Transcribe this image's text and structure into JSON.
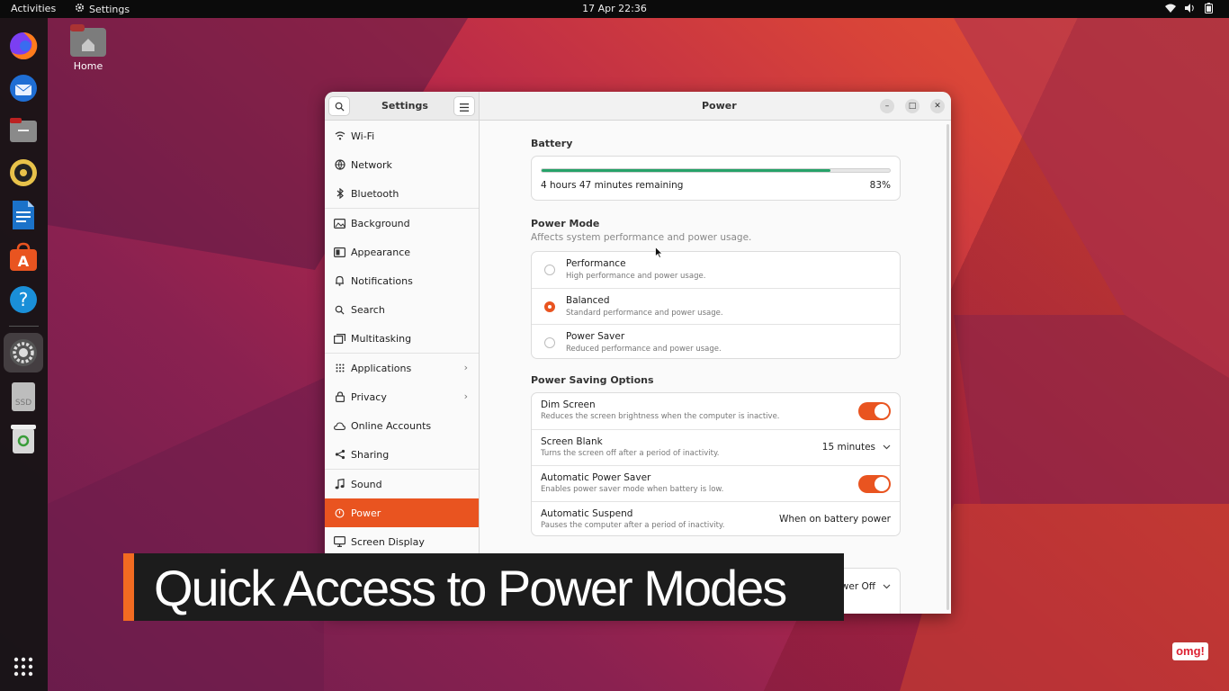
{
  "topbar": {
    "activities": "Activities",
    "app_name": "Settings",
    "clock": "17 Apr  22:36"
  },
  "dock": {
    "items": [
      "firefox-icon",
      "thunderbird-icon",
      "files-icon",
      "rhythmbox-icon",
      "writer-icon",
      "app-center-icon",
      "help-icon",
      "settings-icon",
      "ssd-drive-icon",
      "trash-icon",
      "show-apps-icon"
    ],
    "ssd_label": "SSD"
  },
  "desktop": {
    "home_label": "Home"
  },
  "window": {
    "sidebar_title": "Settings",
    "main_title": "Power",
    "sidebar": [
      {
        "label": "Wi-Fi",
        "icon": "wifi-icon"
      },
      {
        "label": "Network",
        "icon": "network-icon"
      },
      {
        "label": "Bluetooth",
        "icon": "bluetooth-icon"
      },
      {
        "label": "Background",
        "icon": "background-icon"
      },
      {
        "label": "Appearance",
        "icon": "appearance-icon"
      },
      {
        "label": "Notifications",
        "icon": "bell-icon"
      },
      {
        "label": "Search",
        "icon": "search-icon"
      },
      {
        "label": "Multitasking",
        "icon": "multitasking-icon"
      },
      {
        "label": "Applications",
        "icon": "grid-icon"
      },
      {
        "label": "Privacy",
        "icon": "lock-icon"
      },
      {
        "label": "Online Accounts",
        "icon": "cloud-icon"
      },
      {
        "label": "Sharing",
        "icon": "share-icon"
      },
      {
        "label": "Sound",
        "icon": "music-note-icon"
      },
      {
        "label": "Power",
        "icon": "power-icon"
      },
      {
        "label": "Screen Display",
        "icon": "display-icon"
      }
    ],
    "selected": "Power"
  },
  "power": {
    "battery": {
      "title": "Battery",
      "remaining": "4 hours 47 minutes remaining",
      "percent": "83%",
      "level": 0.83
    },
    "mode": {
      "title": "Power Mode",
      "subtitle": "Affects system performance and power usage.",
      "options": [
        {
          "title": "Performance",
          "sub": "High performance and power usage.",
          "selected": false
        },
        {
          "title": "Balanced",
          "sub": "Standard performance and power usage.",
          "selected": true
        },
        {
          "title": "Power Saver",
          "sub": "Reduced performance and power usage.",
          "selected": false
        }
      ]
    },
    "saving": {
      "title": "Power Saving Options",
      "dim_title": "Dim Screen",
      "dim_sub": "Reduces the screen brightness when the computer is inactive.",
      "blank_title": "Screen Blank",
      "blank_sub": "Turns the screen off after a period of inactivity.",
      "blank_value": "15 minutes",
      "auto_saver_title": "Automatic Power Saver",
      "auto_saver_sub": "Enables power saver mode when battery is low.",
      "suspend_title": "Automatic Suspend",
      "suspend_sub": "Pauses the computer after a period of inactivity.",
      "suspend_value": "When on battery power"
    },
    "power_button_value": "wer Off"
  },
  "overlay": {
    "caption": "Quick Access to Power Modes",
    "logo": "omg!"
  },
  "colors": {
    "accent": "#e95420",
    "battery": "#26a269",
    "caption_bar": "#f26b21"
  }
}
